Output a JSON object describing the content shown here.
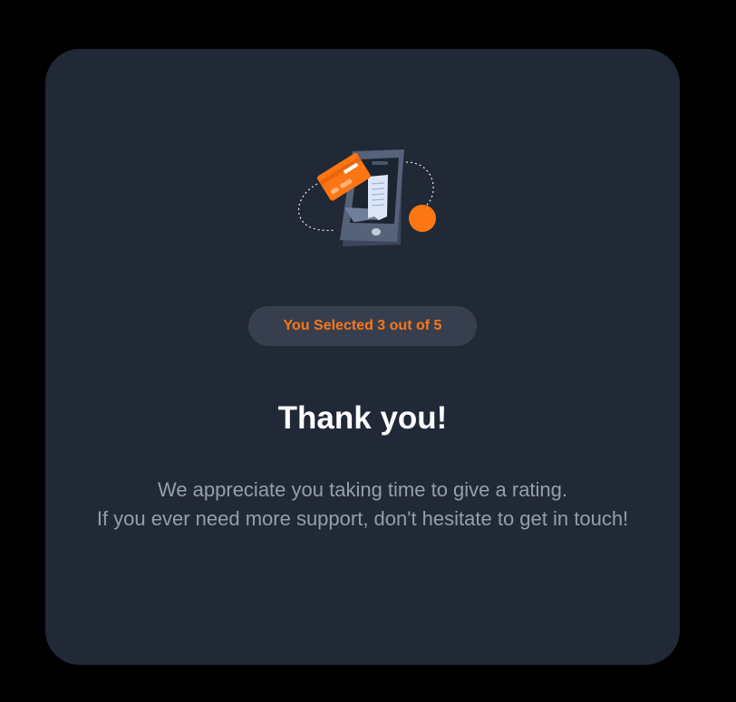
{
  "card": {
    "illustration_icon": "phone-payment-receipt-illustration",
    "badge": {
      "prefix": "You Selected",
      "selected": "3",
      "middle": "out of",
      "total": "5"
    },
    "rating": {
      "selected": 3,
      "max": 5
    },
    "title": "Thank you!",
    "message": {
      "line1": "We appreciate you taking time to give a rating.",
      "line2": "If you ever need more support, don't hesitate to get in touch!"
    }
  },
  "colors": {
    "page_background": "#000000",
    "card_background": "#212836",
    "badge_background": "#373f4f",
    "accent_orange": "#fc7614",
    "title_text": "#ffffff",
    "body_text": "#959eac"
  }
}
